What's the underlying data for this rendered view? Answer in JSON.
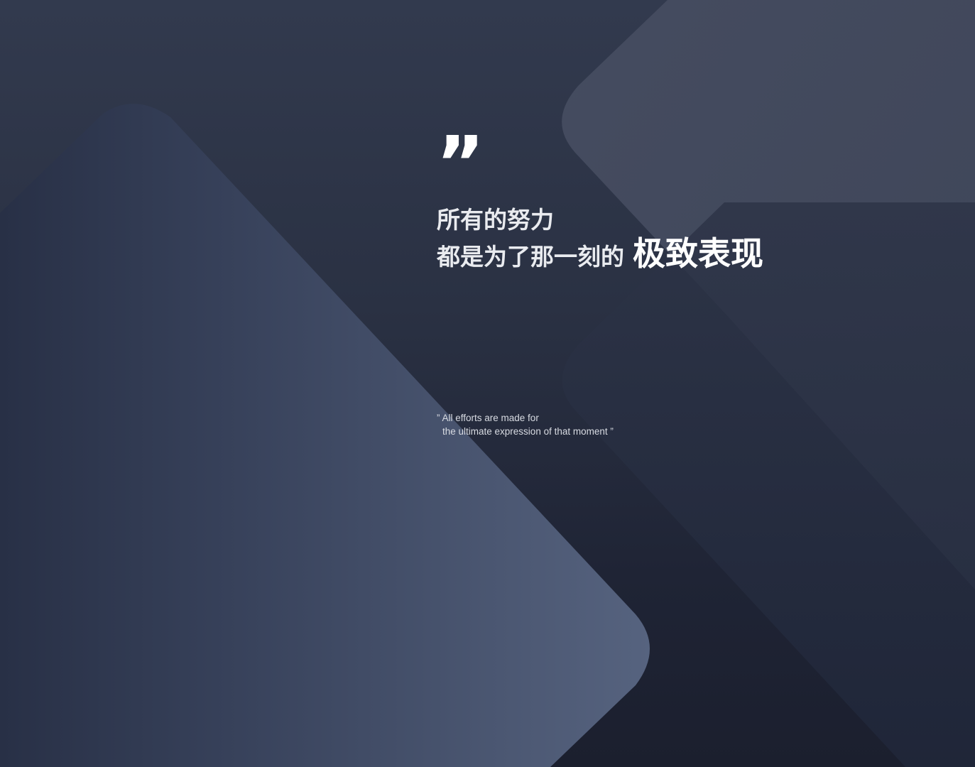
{
  "quote_mark": "”",
  "headline": {
    "line1": "所有的努力",
    "line2_lead": "都是为了那一刻的",
    "line2_emphasis": "极致表现"
  },
  "subtitle": {
    "line1": "” All efforts are made for",
    "line2": "the ultimate expression of that moment ”"
  },
  "colors": {
    "background_top": "#323a4e",
    "background_bottom": "#1b1f2e",
    "left_panel_light": "#515e7a",
    "right_panel": "#454c61",
    "text": "#ffffff"
  }
}
